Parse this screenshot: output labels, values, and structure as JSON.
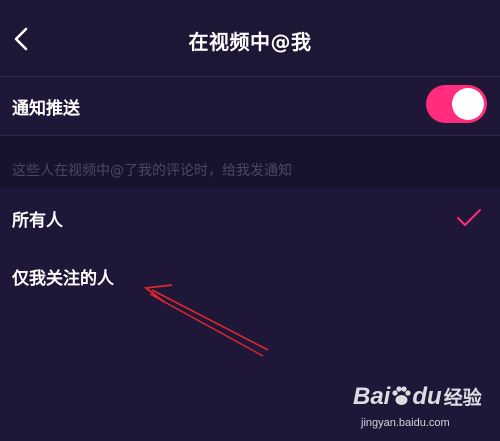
{
  "header": {
    "title": "在视频中@我",
    "back_icon": "chevron-left-icon"
  },
  "notification": {
    "label": "通知推送",
    "enabled": true,
    "toggle_color": "#ff2d7b"
  },
  "hint": {
    "text": "这些人在视频中@了我的评论时，给我发通知"
  },
  "options": [
    {
      "label": "所有人",
      "selected": true
    },
    {
      "label": "仅我关注的人",
      "selected": false
    }
  ],
  "colors": {
    "background": "#1f1737",
    "accent": "#ff2d7b",
    "annotation_arrow": "#e0272f"
  },
  "watermark": {
    "logo_left": "Bai",
    "logo_right": "du",
    "logo_suffix": "经验",
    "url": "jingyan.baidu.com"
  }
}
